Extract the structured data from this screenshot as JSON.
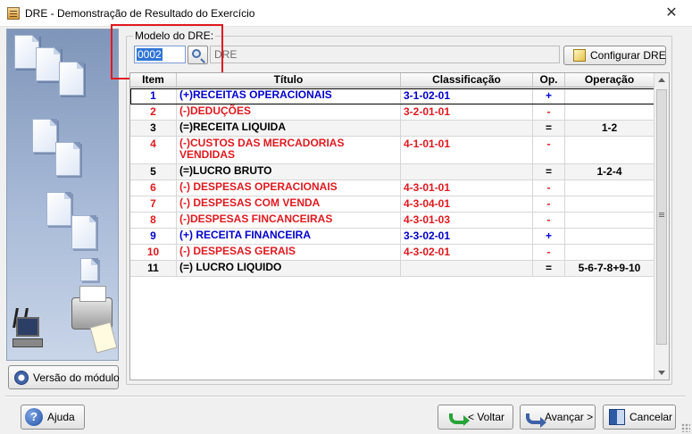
{
  "window": {
    "title": "DRE - Demonstração de Resultado do Exercício",
    "close_glyph": "✕"
  },
  "colors": {
    "positive": "#0000cc",
    "negative": "#e0191f",
    "neutral": "#000000",
    "highlight": "#e0191f"
  },
  "left_panel": {
    "version_button_label": "Versão do módulo"
  },
  "model": {
    "group_label": "Modelo do DRE:",
    "code_value": "0002",
    "description_value": "DRE",
    "configure_label": "Configurar DRE"
  },
  "grid": {
    "columns": {
      "item": "Item",
      "titulo": "Título",
      "classificacao": "Classificação",
      "op": "Op.",
      "operacao": "Operação"
    },
    "rows": [
      {
        "item": "1",
        "titulo": "(+)RECEITAS OPERACIONAIS",
        "classificacao": "3-1-02-01",
        "op": "+",
        "operacao": "",
        "color": "#0000cc"
      },
      {
        "item": "2",
        "titulo": "(-)DEDUÇÕES",
        "classificacao": "3-2-01-01",
        "op": "-",
        "operacao": "",
        "color": "#e0191f"
      },
      {
        "item": "3",
        "titulo": "(=)RECEITA LIQUIDA",
        "classificacao": "",
        "op": "=",
        "operacao": "1-2",
        "color": "#000000"
      },
      {
        "item": "4",
        "titulo": "(-)CUSTOS DAS MERCADORIAS VENDIDAS",
        "classificacao": "4-1-01-01",
        "op": "-",
        "operacao": "",
        "color": "#e0191f"
      },
      {
        "item": "5",
        "titulo": "(=)LUCRO BRUTO",
        "classificacao": "",
        "op": "=",
        "operacao": "1-2-4",
        "color": "#000000"
      },
      {
        "item": "6",
        "titulo": "(-) DESPESAS OPERACIONAIS",
        "classificacao": "4-3-01-01",
        "op": "-",
        "operacao": "",
        "color": "#e0191f"
      },
      {
        "item": "7",
        "titulo": "(-) DESPESAS COM VENDA",
        "classificacao": "4-3-04-01",
        "op": "-",
        "operacao": "",
        "color": "#e0191f"
      },
      {
        "item": "8",
        "titulo": "(-)DESPESAS FINCANCEIRAS",
        "classificacao": "4-3-01-03",
        "op": "-",
        "operacao": "",
        "color": "#e0191f"
      },
      {
        "item": "9",
        "titulo": "(+) RECEITA FINANCEIRA",
        "classificacao": "3-3-02-01",
        "op": "+",
        "operacao": "",
        "color": "#0000cc"
      },
      {
        "item": "10",
        "titulo": "(-) DESPESAS GERAIS",
        "classificacao": "4-3-02-01",
        "op": "-",
        "operacao": "",
        "color": "#e0191f"
      },
      {
        "item": "11",
        "titulo": "(=) LUCRO LIQUIDO",
        "classificacao": "",
        "op": "=",
        "operacao": "5-6-7-8+9-10",
        "color": "#000000"
      }
    ]
  },
  "footer": {
    "help_label": "Ajuda",
    "back_label": "< Voltar",
    "next_label": "Avançar >",
    "cancel_label": "Cancelar",
    "help_glyph": "?"
  }
}
